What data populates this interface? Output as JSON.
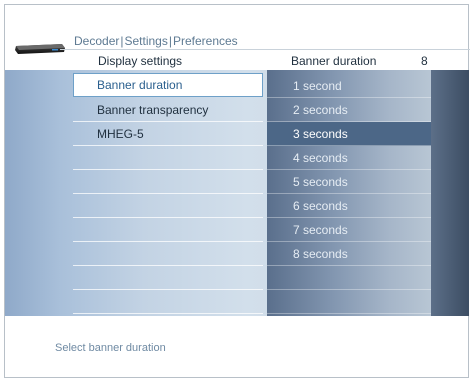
{
  "header": {
    "device_icon": "set-top-box-icon",
    "breadcrumb": [
      "Decoder",
      "Settings",
      "Preferences"
    ],
    "separator": "|",
    "left_column_title": "Display settings",
    "right_column_title": "Banner duration",
    "right_column_value": "8"
  },
  "menu": {
    "items": [
      {
        "label": "Banner duration",
        "selected": true
      },
      {
        "label": "Banner transparency",
        "selected": false
      },
      {
        "label": "MHEG-5",
        "selected": false
      }
    ]
  },
  "options": {
    "items": [
      {
        "label": "1 second",
        "selected": false
      },
      {
        "label": "2 seconds",
        "selected": false
      },
      {
        "label": "3 seconds",
        "selected": true
      },
      {
        "label": "4 seconds",
        "selected": false
      },
      {
        "label": "5 seconds",
        "selected": false
      },
      {
        "label": "6 seconds",
        "selected": false
      },
      {
        "label": "7 seconds",
        "selected": false
      },
      {
        "label": "8 seconds",
        "selected": false
      }
    ]
  },
  "footer": {
    "status": "Select banner duration"
  },
  "colors": {
    "selected_menu_border": "#6ea0c8",
    "selected_menu_text": "#2a5f8e",
    "selected_option_bg": "#4c6787",
    "breadcrumb_text": "#5e7a92"
  }
}
